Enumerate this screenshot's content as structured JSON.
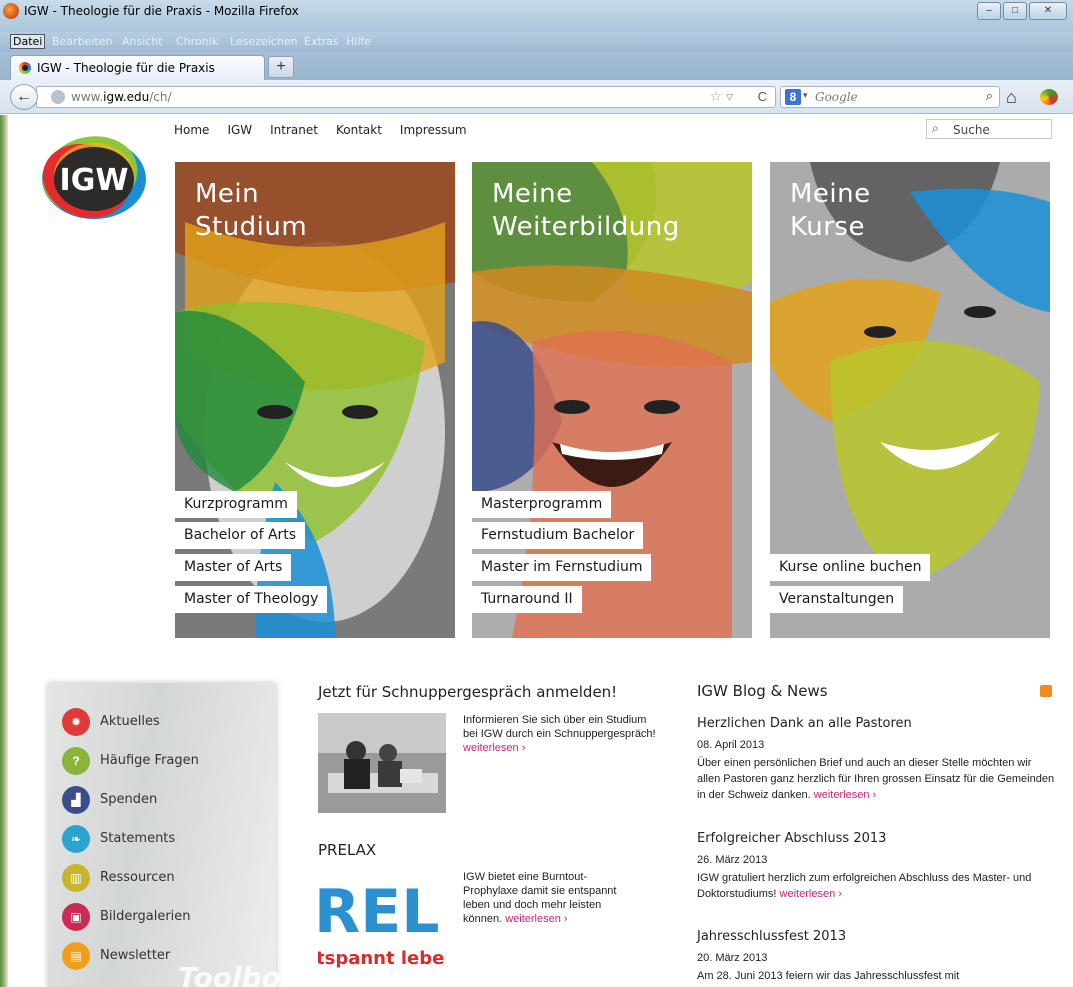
{
  "window": {
    "title": "IGW - Theologie für die Praxis - Mozilla Firefox",
    "minimize": "–",
    "maximize": "□",
    "close": "✕"
  },
  "menubar": {
    "items": [
      "Datei",
      "Bearbeiten",
      "Ansicht",
      "Chronik",
      "Lesezeichen",
      "Extras",
      "Hilfe"
    ]
  },
  "tab": {
    "label": "IGW - Theologie für die Praxis",
    "new_tab": "+"
  },
  "navbar": {
    "back": "←",
    "url_prefix": "www.",
    "url_domain": "igw.edu",
    "url_path": "/ch/",
    "star": "☆ ▿",
    "reload": "C",
    "search_engine_letter": "8",
    "search_arrow": "▾",
    "search_placeholder": "Google",
    "search_glass": "⌕",
    "home": "⌂"
  },
  "site": {
    "logo_text": "IGW",
    "nav": [
      "Home",
      "IGW",
      "Intranet",
      "Kontakt",
      "Impressum"
    ],
    "search_placeholder": "Suche",
    "search_glass": "⌕",
    "panels": [
      {
        "title_line1": "Mein",
        "title_line2": "Studium",
        "links": [
          "Kurzprogramm",
          "Bachelor of Arts",
          "Master of Arts",
          "Master of Theology"
        ]
      },
      {
        "title_line1": "Meine",
        "title_line2": "Weiterbildung",
        "links": [
          "Masterprogramm",
          "Fernstudium Bachelor",
          "Master im Fernstudium",
          "Turnaround II"
        ]
      },
      {
        "title_line1": "Meine",
        "title_line2": "Kurse",
        "links": [
          "Kurse online buchen",
          "Veranstaltungen"
        ]
      }
    ],
    "toolbox": {
      "items": [
        {
          "label": "Aktuelles",
          "icon": "gear-icon",
          "glyph": "✹",
          "color": "#e03a3a"
        },
        {
          "label": "Häufige Fragen",
          "icon": "question-icon",
          "glyph": "?",
          "color": "#8cb43a"
        },
        {
          "label": "Spenden",
          "icon": "chart-icon",
          "glyph": "▟",
          "color": "#3a4e8c"
        },
        {
          "label": "Statements",
          "icon": "leaf-icon",
          "glyph": "❧",
          "color": "#2aa3cf"
        },
        {
          "label": "Ressourcen",
          "icon": "books-icon",
          "glyph": "▥",
          "color": "#c9b431"
        },
        {
          "label": "Bildergalerien",
          "icon": "gallery-icon",
          "glyph": "▣",
          "color": "#c82b55"
        },
        {
          "label": "Newsletter",
          "icon": "newsletter-icon",
          "glyph": "▤",
          "color": "#f29e1b"
        }
      ],
      "word": "Toolbox"
    },
    "schnupper": {
      "heading": "Jetzt für Schnuppergespräch anmelden!",
      "text": "Informieren Sie sich über ein Studium bei IGW durch ein Schnuppergespräch!",
      "more": "weiterlesen ›"
    },
    "prelax": {
      "heading": "PRELAX",
      "img_big": "REL",
      "img_small": "tspannt leben -",
      "text": "IGW bietet eine Burntout-Prophylaxe damit sie entspannt leben und doch mehr leisten können.",
      "more": "weiterlesen ›"
    },
    "blog": {
      "title": "IGW Blog & News",
      "items": [
        {
          "title": "Herzlichen Dank an alle Pastoren",
          "date": "08. April 2013",
          "text": "Über einen persönlichen Brief und auch an dieser Stelle möchten wir allen Pastoren ganz herzlich für Ihren grossen Einsatz für die Gemeinden in der Schweiz danken.",
          "more": "weiterlesen ›"
        },
        {
          "title": "Erfolgreicher Abschluss 2013",
          "date": "26. März 2013",
          "text": "IGW gratuliert herzlich zum erfolgreichen Abschluss des Master- und Doktorstudiums!",
          "more": "weiterlesen ›"
        },
        {
          "title": "Jahresschlussfest 2013",
          "date": "20. März 2013",
          "text": "Am 28. Juni 2013 feiern wir das Jahresschlussfest mit",
          "more": ""
        }
      ]
    }
  }
}
